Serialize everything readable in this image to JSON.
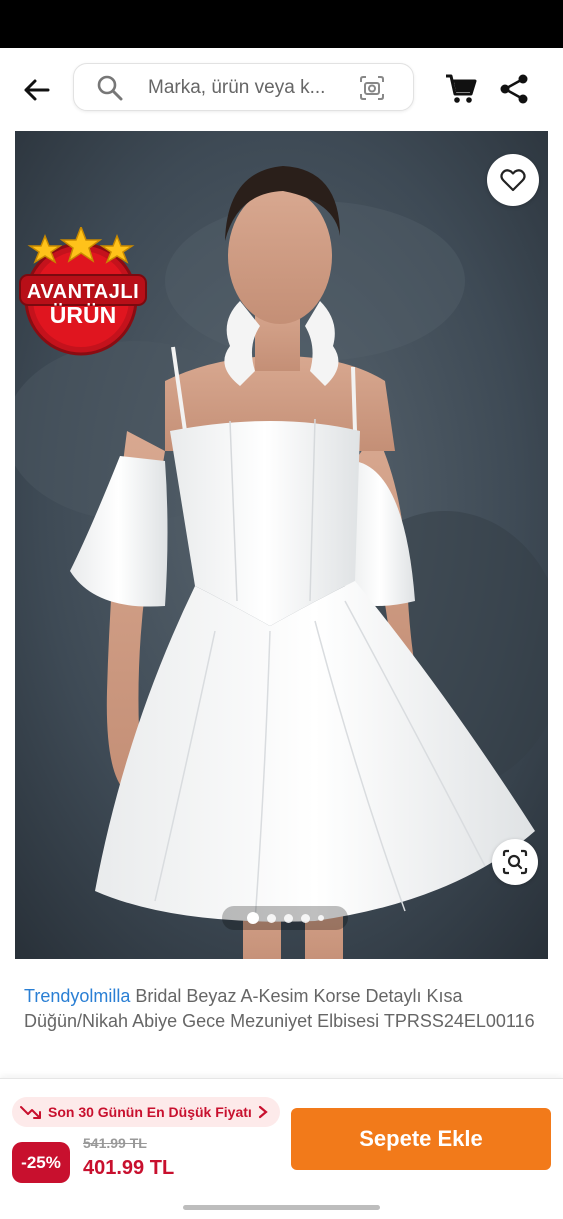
{
  "search": {
    "placeholder": "Marka, ürün veya k..."
  },
  "icons": {
    "back": "arrow-left-icon",
    "search": "magnifier-icon",
    "camera_search": "camera-search-icon",
    "cart": "shopping-cart-icon",
    "share": "share-icon",
    "favorite": "heart-outline-icon",
    "visual_search": "lens-scan-icon",
    "price_trend": "trend-down-icon",
    "chevron": "chevron-right-icon"
  },
  "gallery": {
    "badge_line1": "AVANTAJLI",
    "badge_line2": "ÜRÜN",
    "image_count": 5,
    "active_index": 0
  },
  "product": {
    "brand": "Trendyolmilla",
    "title": "Bridal Beyaz A-Kesim Korse Detaylı Kısa Düğün/Nikah Abiye Gece Mezuniyet Elbisesi TPRSS24EL00116"
  },
  "price_panel": {
    "low_price_label": "Son 30 Günün En Düşük Fiyatı",
    "discount": "-25%",
    "old_price": "541.99 TL",
    "new_price": "401.99 TL",
    "add_to_cart_label": "Sepete Ekle"
  },
  "colors": {
    "brand_orange": "#f27a1a",
    "discount_red": "#c8102e",
    "brand_link_blue": "#2a7fd4",
    "pill_background": "#fdeaea"
  }
}
